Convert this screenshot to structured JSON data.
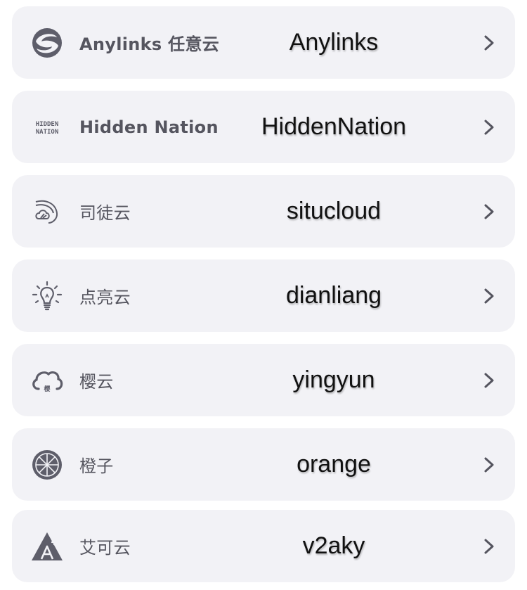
{
  "items": [
    {
      "icon": "anylinks-swirl-logo-icon",
      "label": "Anylinks 任意云",
      "code": "Anylinks"
    },
    {
      "icon": "hidden-nation-logo-icon",
      "label": "Hidden Nation",
      "code": "HiddenNation",
      "icon_text": "HIDDEN NATION"
    },
    {
      "icon": "cloud-sketch-logo-icon",
      "label": "司徒云",
      "code": "situcloud"
    },
    {
      "icon": "lightbulb-icon",
      "label": "点亮云",
      "code": "dianliang"
    },
    {
      "icon": "cloud-outline-icon",
      "label": "樱云",
      "code": "yingyun",
      "icon_text": "樱"
    },
    {
      "icon": "orange-slice-icon",
      "label": "橙子",
      "code": "orange"
    },
    {
      "icon": "a-plus-triangle-icon",
      "label": "艾可云",
      "code": "v2aky"
    }
  ],
  "chevron_icon": "chevron-right-icon",
  "colors": {
    "card_bg": "#f2f2f6",
    "icon": "#5e5e6a",
    "label": "#55555f",
    "code": "#111111"
  }
}
